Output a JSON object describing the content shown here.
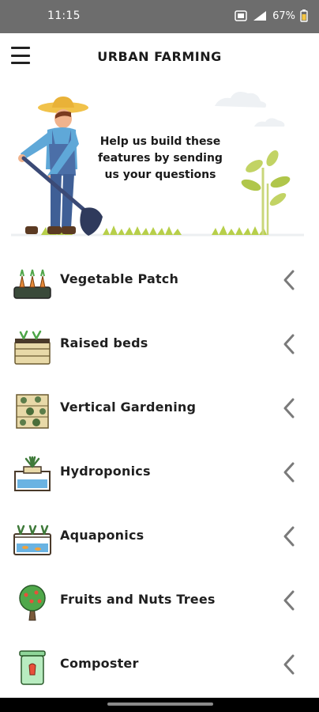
{
  "status_bar": {
    "time": "11:15",
    "network": "4G",
    "battery": "67%"
  },
  "header": {
    "title": "URBAN FARMING",
    "menu_icon": "hamburger-menu-icon"
  },
  "hero": {
    "message": "Help us build these features by sending us your questions",
    "illustration": "farmer-with-shovel"
  },
  "colors": {
    "status_bar": "#6d6d6d",
    "accent_green": "#b7cf4a",
    "text": "#1f1f1f",
    "chevron": "#7a7a7a"
  },
  "features": [
    {
      "label": "Vegetable Patch",
      "icon": "vegetable-patch-icon"
    },
    {
      "label": "Raised beds",
      "icon": "raised-beds-icon"
    },
    {
      "label": "Vertical Gardening",
      "icon": "vertical-gardening-icon"
    },
    {
      "label": "Hydroponics",
      "icon": "hydroponics-icon"
    },
    {
      "label": "Aquaponics",
      "icon": "aquaponics-icon"
    },
    {
      "label": "Fruits and Nuts Trees",
      "icon": "fruit-tree-icon"
    },
    {
      "label": "Composter",
      "icon": "composter-icon"
    }
  ]
}
